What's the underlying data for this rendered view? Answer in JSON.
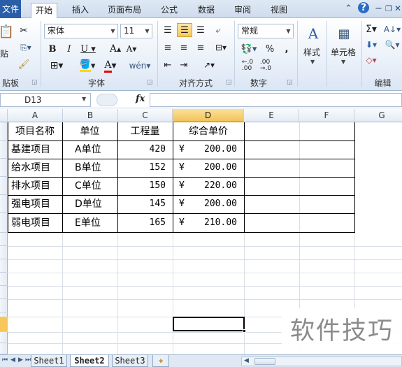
{
  "ribbon_tabs": [
    "文件",
    "开始",
    "插入",
    "页面布局",
    "公式",
    "数据",
    "审阅",
    "视图"
  ],
  "ribbon": {
    "clipboard": {
      "paste_label": "贴",
      "group_label": "贴板"
    },
    "font": {
      "name": "宋体",
      "size": "11",
      "group_label": "字体"
    },
    "alignment": {
      "group_label": "对齐方式"
    },
    "number": {
      "format": "常规",
      "percent": "%",
      "comma": ",",
      "group_label": "数字"
    },
    "styles": {
      "label": "样式"
    },
    "cells": {
      "label": "单元格"
    },
    "editing": {
      "group_label": "编辑"
    }
  },
  "formula_bar": {
    "name_box": "D13",
    "fx": "fx",
    "value": ""
  },
  "columns": [
    "A",
    "B",
    "C",
    "D",
    "E",
    "F",
    "G"
  ],
  "table": {
    "headers": [
      "项目名称",
      "单位",
      "工程量",
      "综合单价"
    ],
    "rows": [
      [
        "基建项目",
        "A单位",
        "420",
        "¥",
        "200.00"
      ],
      [
        "给水项目",
        "B单位",
        "152",
        "¥",
        "200.00"
      ],
      [
        "排水项目",
        "C单位",
        "150",
        "¥",
        "220.00"
      ],
      [
        "强电项目",
        "D单位",
        "145",
        "¥",
        "200.00"
      ],
      [
        "弱电项目",
        "E单位",
        "165",
        "¥",
        "210.00"
      ]
    ]
  },
  "sheet_tabs": [
    "Sheet1",
    "Sheet2",
    "Sheet3"
  ],
  "active_sheet": "Sheet2",
  "watermark": "软件技巧",
  "colors": {
    "accent_file_tab": "#2a5ea8",
    "selection_header": "#f2c45a",
    "ribbon_border": "#9eb6ce"
  }
}
